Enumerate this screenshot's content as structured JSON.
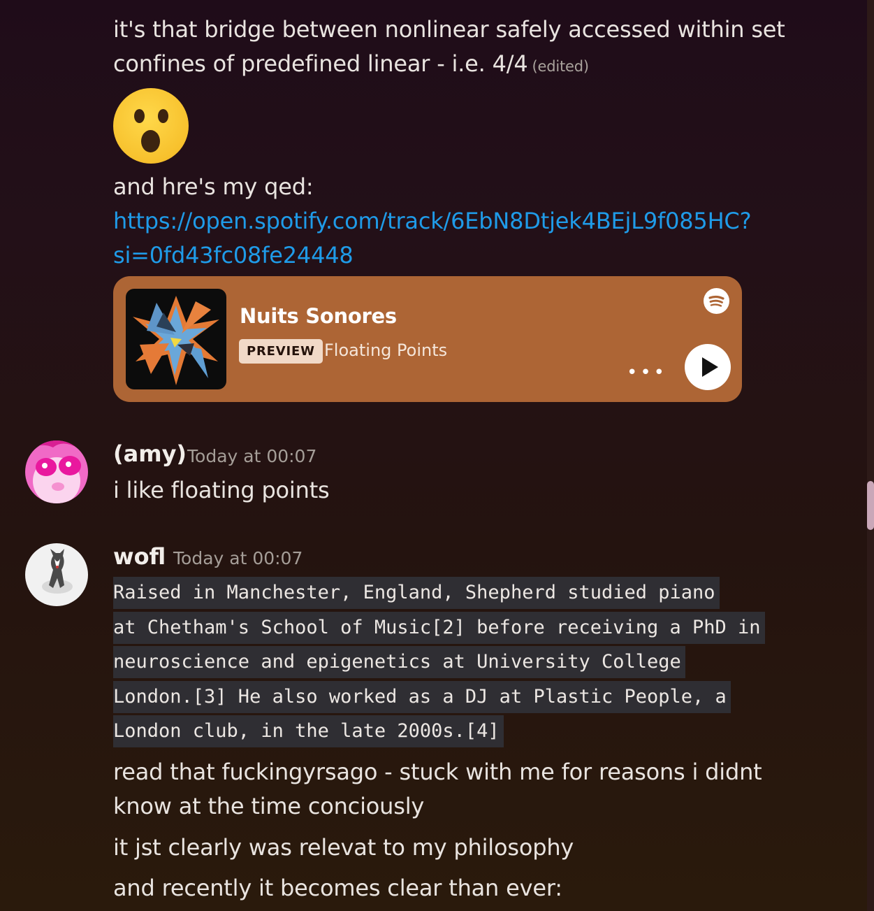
{
  "messages": {
    "first": {
      "line1": "it's that bridge between nonlinear safely accessed within set",
      "line2": "confines of predefined linear - i.e. 4/4",
      "edited": "(edited)",
      "emoji": "astonished-face",
      "line3": "and hre's my qed:",
      "link_line1": "https://open.spotify.com/track/6EbN8Dtjek4BEjL9f085HC?",
      "link_line2": "si=0fd43fc08fe24448"
    },
    "embed": {
      "title": "Nuits Sonores",
      "badge": "PREVIEW",
      "artist": "Floating Points",
      "more": "•••",
      "service_icon": "spotify-icon",
      "color": "#ad6535"
    },
    "amy": {
      "username": "(amy)",
      "timestamp": "Today at 00:07",
      "text": "i like floating points"
    },
    "wofl": {
      "username": "wofl",
      "timestamp": "Today at 00:07",
      "code_lines": [
        "Raised in Manchester, England, Shepherd studied piano",
        "at Chetham's School of Music[2] before receiving a PhD in",
        "neuroscience and epigenetics at University College",
        "London.[3] He also worked as a DJ at Plastic People, a",
        "London club, in the late 2000s.[4]"
      ],
      "text1_line1": "read that fuckingyrsago - stuck with me for reasons i didnt",
      "text1_line2": "know at  the time conciously",
      "text2": "it jst clearly was relevat to my philosophy",
      "text3": "and recently it becomes clear than ever:"
    }
  },
  "colors": {
    "link": "#1f9be8",
    "code_bg": "#2f2e33",
    "scroll_thumb": "#c9a7b8"
  }
}
